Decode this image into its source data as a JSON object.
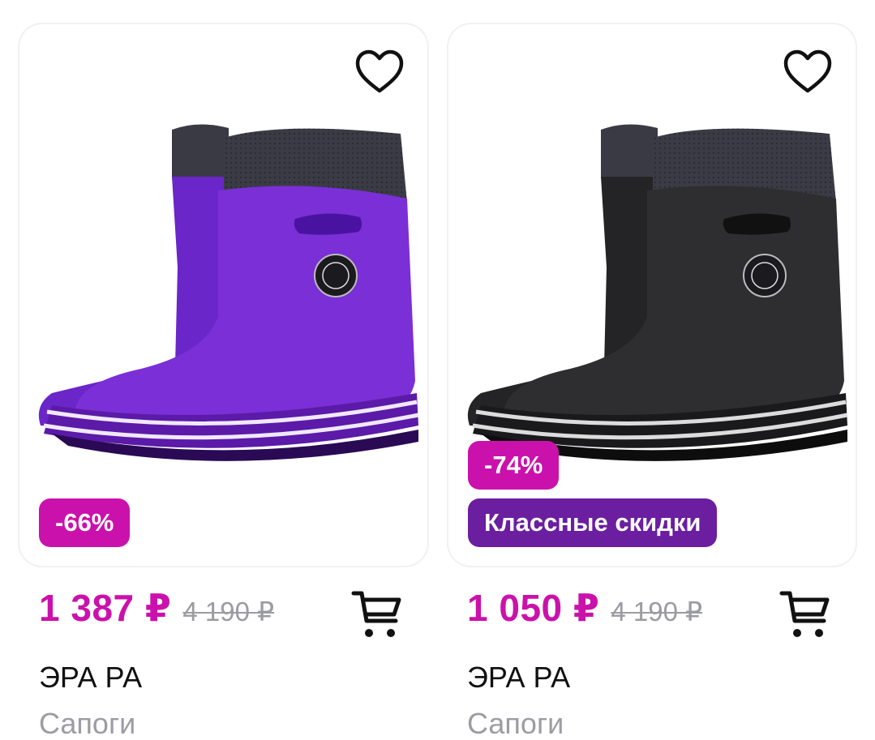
{
  "products": [
    {
      "discount": "-66%",
      "promo": "",
      "price": "1 387 ₽",
      "old_price": "4 190 ₽",
      "brand": "ЭРА РА",
      "category": "Сапоги",
      "boot_color": "#7b2fd6",
      "boot_shade": "#5a1bb0",
      "image": "purple-rubber-boots"
    },
    {
      "discount": "-74%",
      "promo": "Классные скидки",
      "price": "1 050 ₽",
      "old_price": "4 190 ₽",
      "brand": "ЭРА РА",
      "category": "Сапоги",
      "boot_color": "#2e2e30",
      "boot_shade": "#151516",
      "image": "black-rubber-boots"
    }
  ],
  "colors": {
    "accent": "#cb11ab",
    "promo": "#6b1ea0",
    "muted": "#9c9ca4"
  },
  "icons": {
    "favorite": "heart-outline-icon",
    "cart": "cart-icon"
  }
}
